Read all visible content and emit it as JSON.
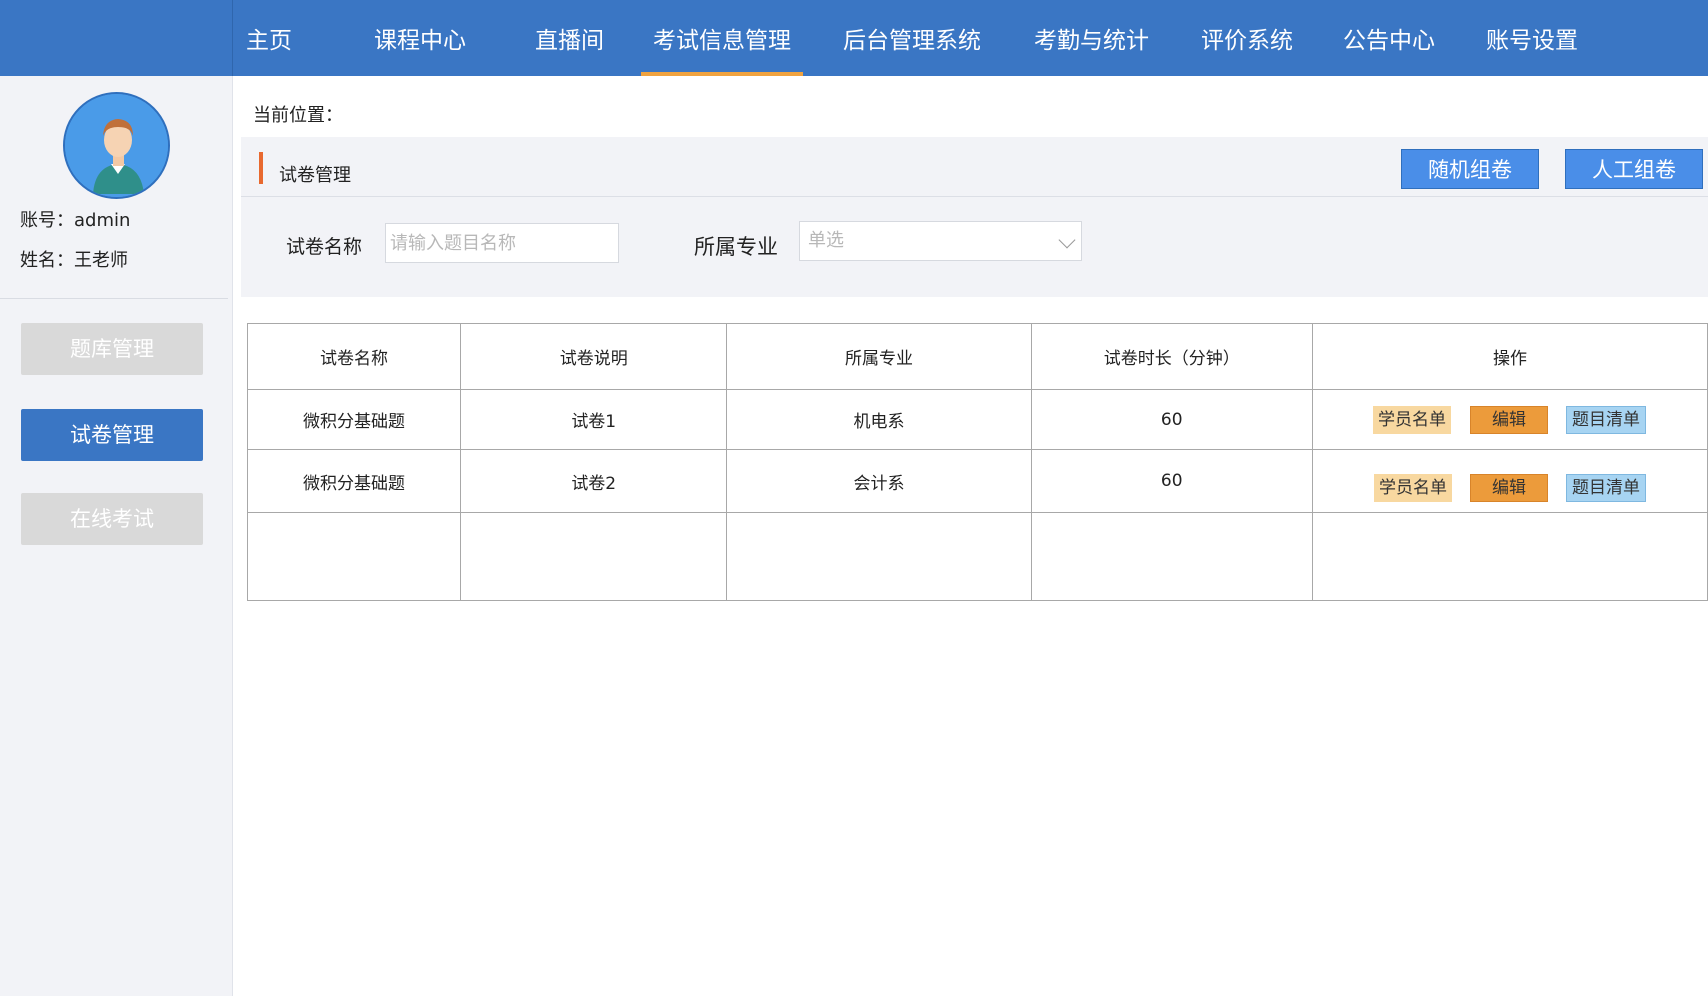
{
  "nav": {
    "items": [
      {
        "label": "主页"
      },
      {
        "label": "课程中心"
      },
      {
        "label": "直播间"
      },
      {
        "label": "考试信息管理"
      },
      {
        "label": "后台管理系统"
      },
      {
        "label": "考勤与统计"
      },
      {
        "label": "评价系统"
      },
      {
        "label": "公告中心"
      },
      {
        "label": "账号设置"
      }
    ],
    "active": "考试信息管理"
  },
  "sidebar": {
    "account_line": "账号：admin",
    "name_line": "姓名：王老师",
    "buttons": [
      {
        "label": "题库管理"
      },
      {
        "label": "试卷管理"
      },
      {
        "label": "在线考试"
      }
    ],
    "active": "试卷管理"
  },
  "breadcrumb": {
    "label": "当前位置："
  },
  "panel": {
    "title": "试卷管理",
    "random_button": "随机组卷",
    "manual_button": "人工组卷",
    "name_filter_label": "试卷名称",
    "name_filter_placeholder": "请输入题目名称",
    "major_filter_label": "所属专业",
    "major_filter_value": "单选"
  },
  "table": {
    "headers": [
      "试卷名称",
      "试卷说明",
      "所属专业",
      "试卷时长（分钟）",
      "操作"
    ],
    "rows": [
      {
        "name": "微积分基础题",
        "desc": "试卷1",
        "major": "机电系",
        "duration": "60"
      },
      {
        "name": "微积分基础题",
        "desc": "试卷2",
        "major": "会计系",
        "duration": "60"
      }
    ],
    "actions": {
      "students": "学员名单",
      "edit": "编辑",
      "questions": "题目清单"
    }
  },
  "colors": {
    "primary": "#3a76c4",
    "accent": "#f0a340",
    "title_bar": "#e8692f"
  }
}
